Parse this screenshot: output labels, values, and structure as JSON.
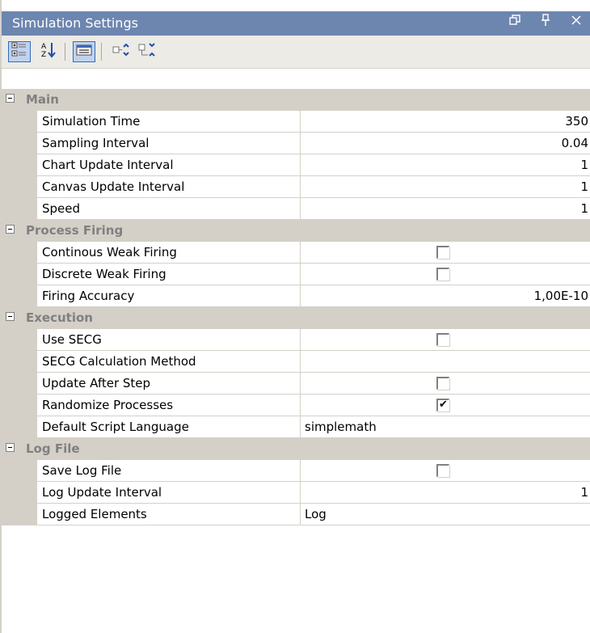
{
  "window": {
    "title": "Simulation Settings"
  },
  "title_buttons": [
    {
      "name": "restore-icon",
      "glyph": "❐"
    },
    {
      "name": "pin-icon",
      "glyph": "⨪"
    },
    {
      "name": "close-icon",
      "glyph": "×"
    }
  ],
  "toolbar": {
    "categorized_icon": "categorized-icon",
    "alphabetical_icon": "alphabetical-icon",
    "property_pages_icon": "property-pages-icon",
    "expand_icon": "expand-all-icon",
    "collapse_icon": "collapse-all-icon",
    "alpha_text": "A Z"
  },
  "categories": [
    {
      "label": "Main",
      "rows": [
        {
          "name": "Simulation Time",
          "value": "350",
          "type": "number"
        },
        {
          "name": "Sampling Interval",
          "value": "0.04",
          "type": "number"
        },
        {
          "name": "Chart Update Interval",
          "value": "1",
          "type": "number"
        },
        {
          "name": "Canvas Update Interval",
          "value": "1",
          "type": "number"
        },
        {
          "name": "Speed",
          "value": "1",
          "type": "number"
        }
      ]
    },
    {
      "label": "Process Firing",
      "rows": [
        {
          "name": "Continous Weak Firing",
          "value": false,
          "type": "checkbox"
        },
        {
          "name": "Discrete Weak Firing",
          "value": false,
          "type": "checkbox"
        },
        {
          "name": "Firing Accuracy",
          "value": "1,00E-10",
          "type": "number"
        }
      ]
    },
    {
      "label": "Execution",
      "rows": [
        {
          "name": "Use SECG",
          "value": false,
          "type": "checkbox"
        },
        {
          "name": "SECG Calculation Method",
          "value": "",
          "type": "text"
        },
        {
          "name": "Update After Step",
          "value": false,
          "type": "checkbox"
        },
        {
          "name": "Randomize Processes",
          "value": true,
          "type": "checkbox"
        },
        {
          "name": "Default Script Language",
          "value": "simplemath",
          "type": "text"
        }
      ]
    },
    {
      "label": "Log File",
      "rows": [
        {
          "name": "Save Log File",
          "value": false,
          "type": "checkbox"
        },
        {
          "name": "Log Update Interval",
          "value": "1",
          "type": "number"
        },
        {
          "name": "Logged Elements",
          "value": "Log",
          "type": "text"
        }
      ]
    }
  ]
}
